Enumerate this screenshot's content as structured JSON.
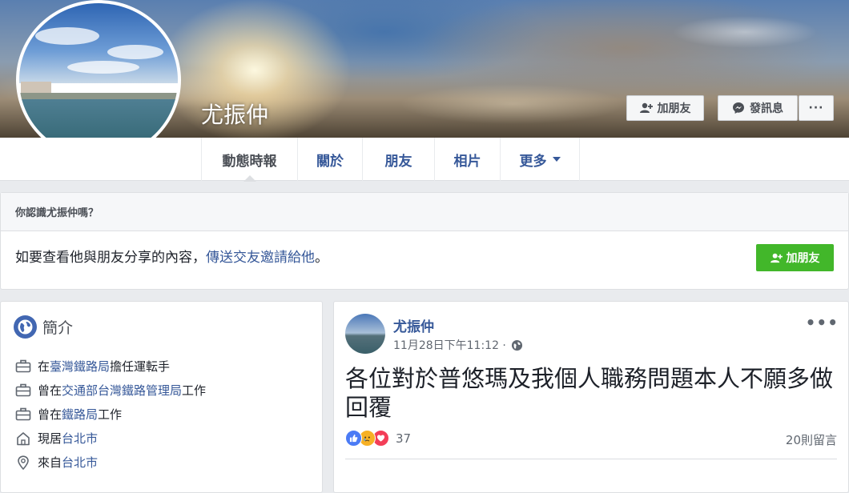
{
  "profile": {
    "name": "尤振仲",
    "add_friend_label": "加朋友",
    "message_label": "發訊息",
    "more_label": "···"
  },
  "tabs": [
    {
      "label": "動態時報"
    },
    {
      "label": "關於"
    },
    {
      "label": "朋友"
    },
    {
      "label": "相片"
    },
    {
      "label": "更多"
    }
  ],
  "know_box": {
    "heading": "你認識尤振仲嗎？",
    "text": "如要查看他與朋友分享的內容，",
    "link": "傳送交友邀請給他",
    "end": "。",
    "button_label": "加朋友"
  },
  "intro": {
    "title": "簡介",
    "items": [
      {
        "icon": "briefcase-icon",
        "prefix": "在",
        "link": "臺灣鐵路局",
        "suffix": "擔任運転手"
      },
      {
        "icon": "briefcase-icon",
        "prefix": "曾在",
        "link": "交通部台灣鐵路管理局",
        "suffix": "工作"
      },
      {
        "icon": "briefcase-icon",
        "prefix": "曾在",
        "link": "鐵路局",
        "suffix": "工作"
      },
      {
        "icon": "home-icon",
        "prefix": "現居",
        "link": "台北市",
        "suffix": ""
      },
      {
        "icon": "location-pin-icon",
        "prefix": "來自",
        "link": "台北市",
        "suffix": ""
      }
    ]
  },
  "post": {
    "author": "尤振仲",
    "time": "11月28日下午11:12 ·",
    "text": "各位對於普悠瑪及我個人職務問題本人不願多做回覆",
    "reaction_count": "37",
    "comments": "20則留言",
    "menu": "•••"
  },
  "colors": {
    "link": "#365899",
    "green": "#42b72a",
    "bg": "#e9ebee"
  }
}
